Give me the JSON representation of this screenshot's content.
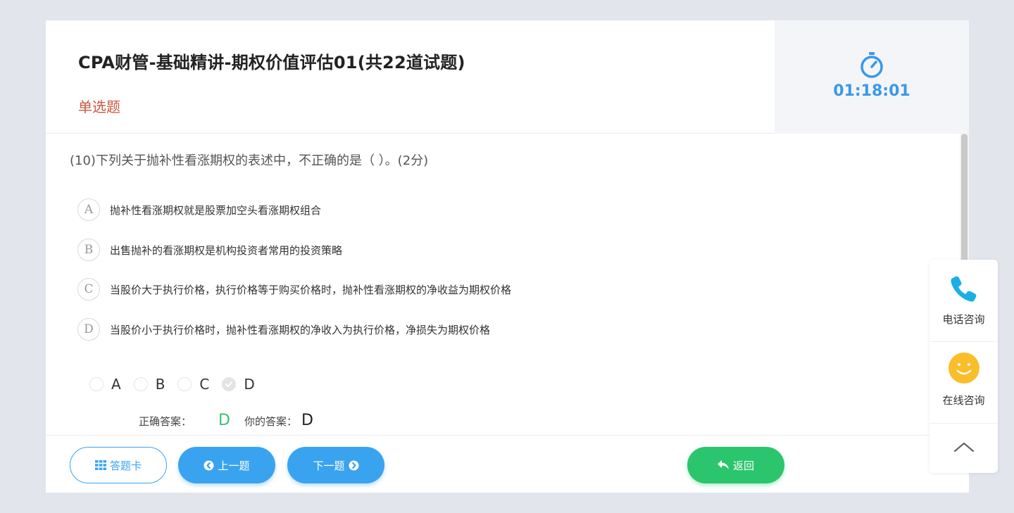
{
  "header": {
    "title": "CPA财管-基础精讲-期权价值评估01(共22道试题)",
    "question_type": "单选题",
    "timer": "01:18:01"
  },
  "question": {
    "text": "(10)下列关于抛补性看涨期权的表述中，不正确的是（      ）。(2分)",
    "options": [
      {
        "letter": "A",
        "text": "抛补性看涨期权就是股票加空头看涨期权组合"
      },
      {
        "letter": "B",
        "text": "出售抛补的看涨期权是机构投资者常用的投资策略"
      },
      {
        "letter": "C",
        "text": "当股价大于执行价格，执行价格等于购买价格时，抛补性看涨期权的净收益为期权价格"
      },
      {
        "letter": "D",
        "text": "当股价小于执行价格时，抛补性看涨期权的净收入为执行价格，净损失为期权价格"
      }
    ]
  },
  "choices": {
    "labels": [
      "A",
      "B",
      "C",
      "D"
    ],
    "selected": "D"
  },
  "answer": {
    "correct_label": "正确答案：",
    "correct_value": "D",
    "yours_label": "你的答案：",
    "yours_value": "D"
  },
  "footer": {
    "card_label": "答题卡",
    "prev_label": "上一题",
    "next_label": "下一题",
    "back_label": "返回"
  },
  "side_panel": {
    "phone_label": "电话咨询",
    "online_label": "在线咨询"
  },
  "colors": {
    "accent_blue": "#3aa3ef",
    "timer_blue": "#3a98e8",
    "success_green": "#2bc56e",
    "correct_green": "#3bbf72",
    "question_type_red": "#c9573f",
    "phone_cyan": "#1ab0e3",
    "smiley_yellow": "#f9be2a"
  }
}
